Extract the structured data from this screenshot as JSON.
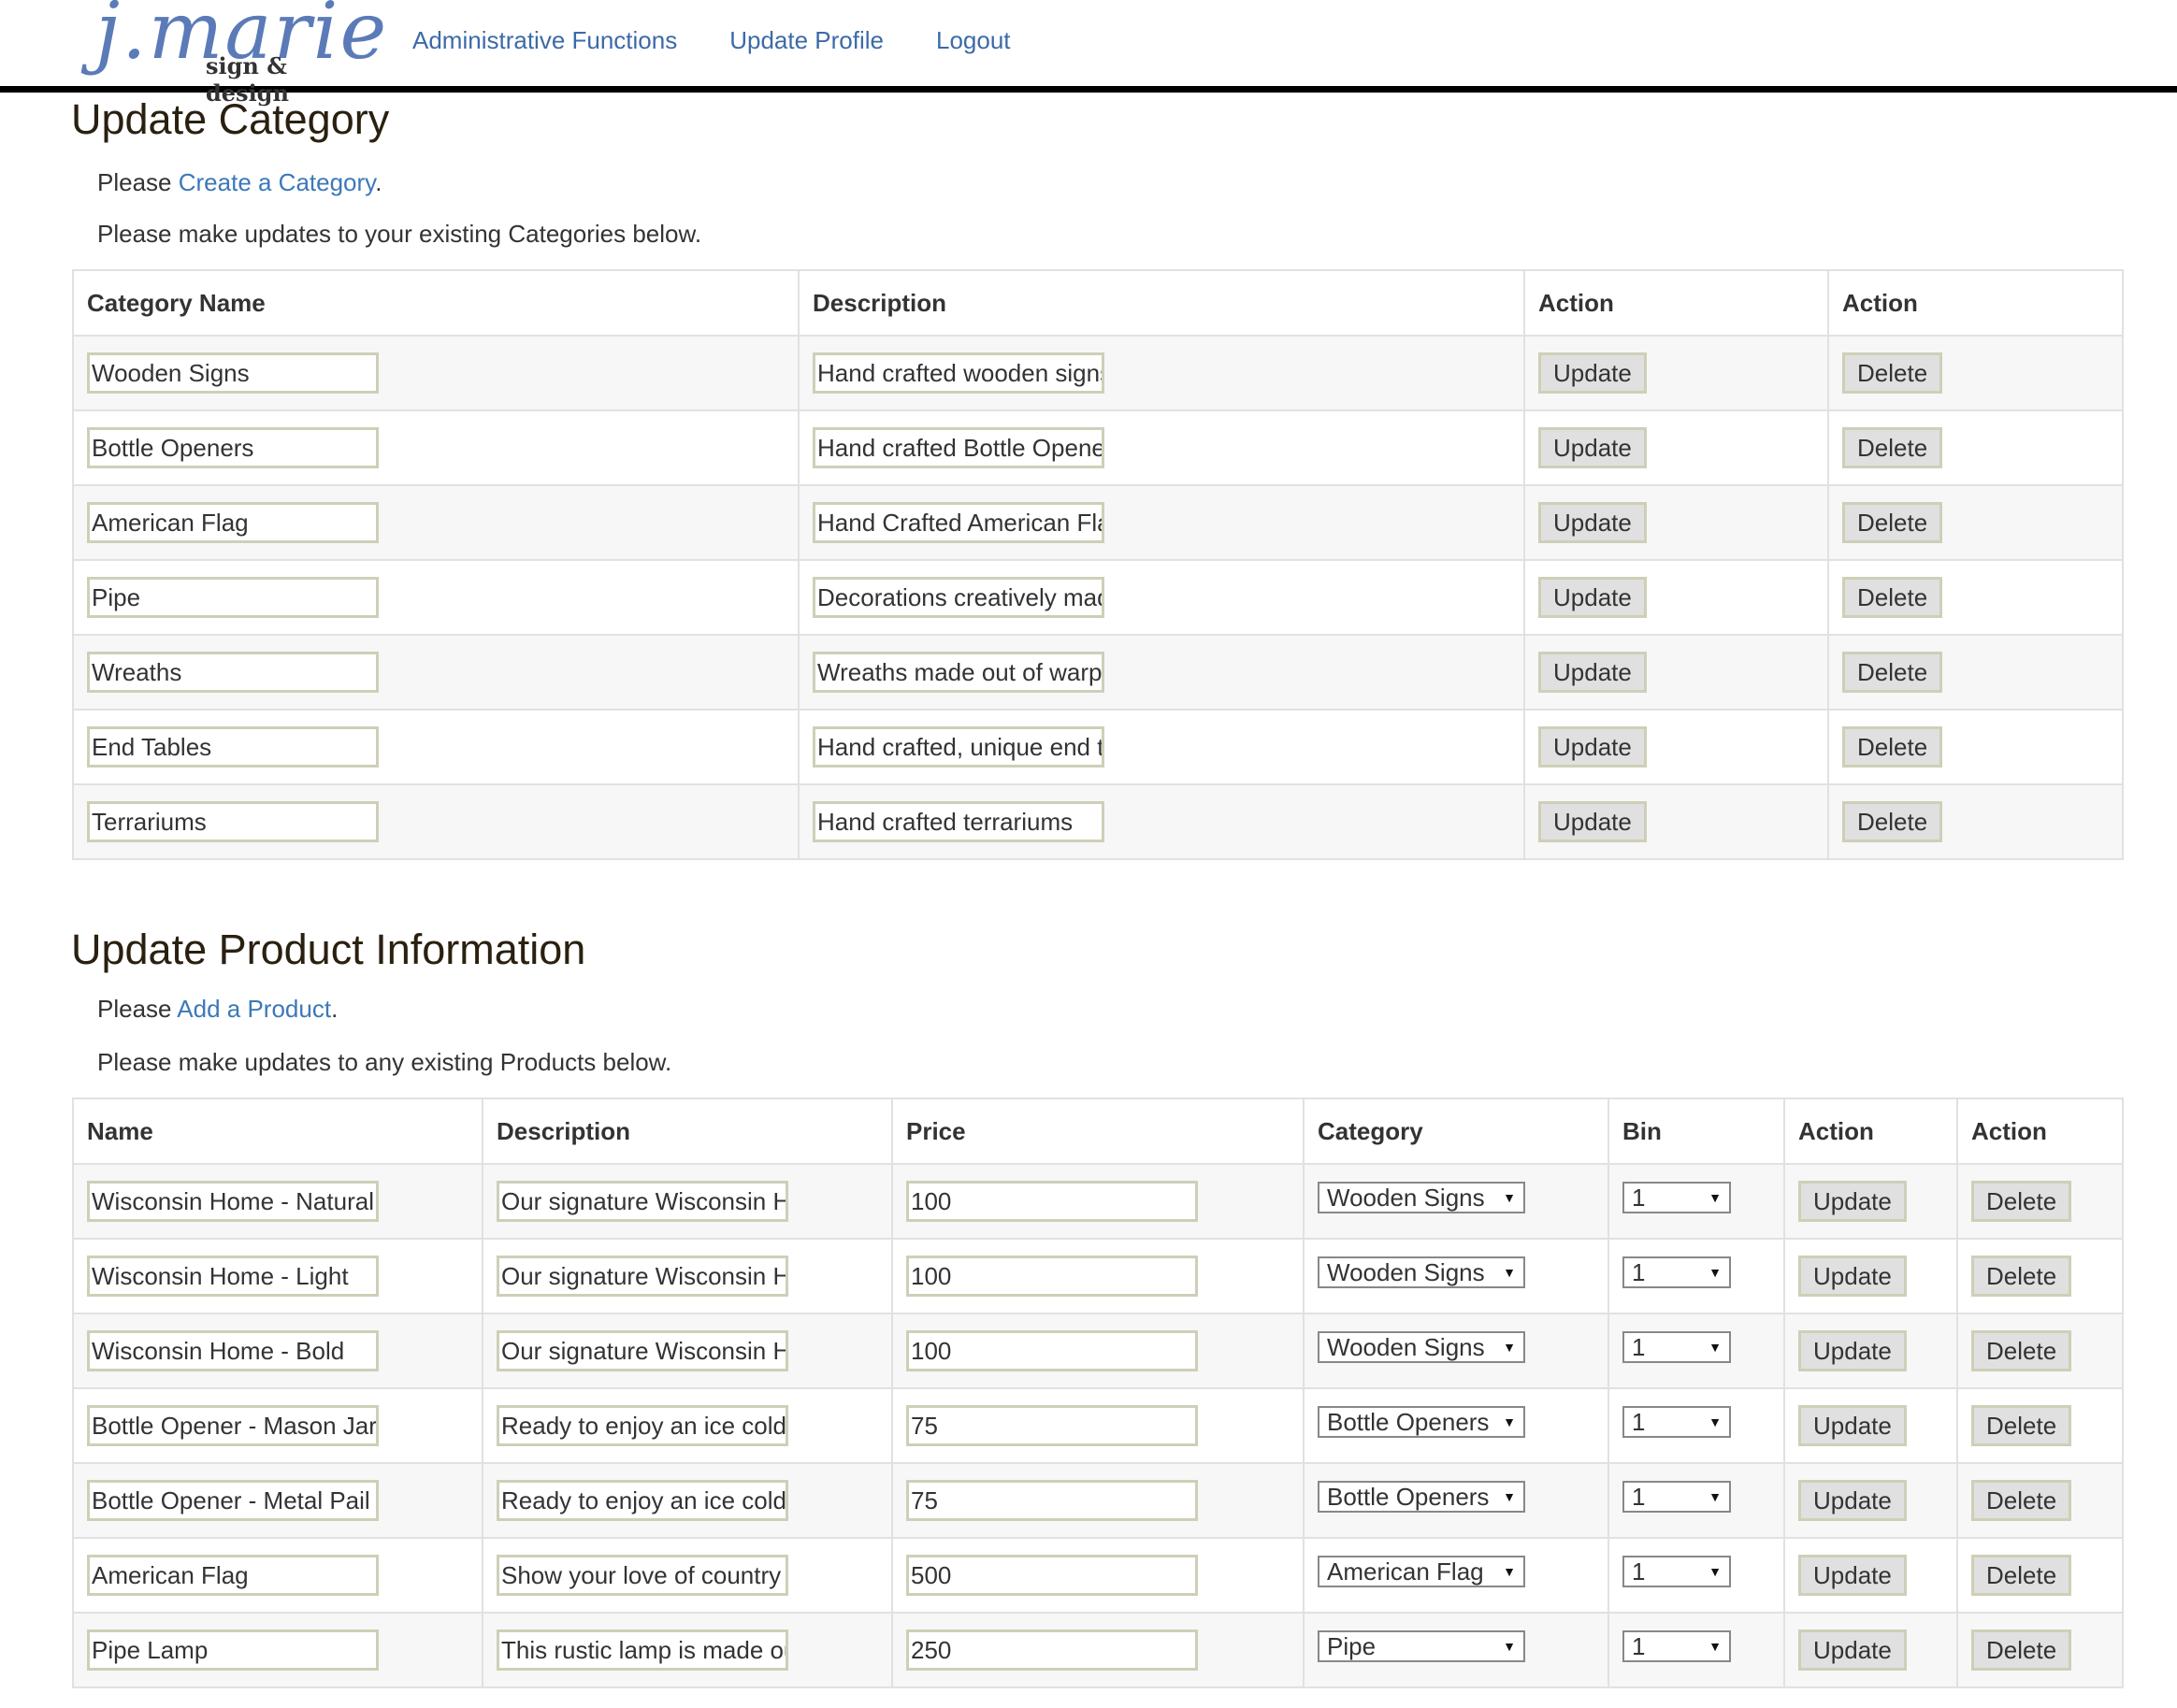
{
  "header": {
    "logo_script": "j.marie",
    "logo_sub": "sign & design",
    "nav": [
      "Administrative Functions",
      "Update Profile",
      "Logout"
    ]
  },
  "categories_section": {
    "title": "Update Category",
    "intro_prefix": "Please ",
    "intro_link": "Create a Category",
    "intro_suffix": ".",
    "subtitle": "Please make updates to your existing Categories below.",
    "columns": [
      "Category Name",
      "Description",
      "Action",
      "Action"
    ],
    "rows": [
      {
        "name": "Wooden Signs",
        "description": "Hand crafted wooden signs"
      },
      {
        "name": "Bottle Openers",
        "description": "Hand crafted Bottle Openers"
      },
      {
        "name": "American Flag",
        "description": "Hand Crafted American Flag"
      },
      {
        "name": "Pipe",
        "description": "Decorations creatively made"
      },
      {
        "name": "Wreaths",
        "description": "Wreaths made out of warp"
      },
      {
        "name": "End Tables",
        "description": "Hand crafted, unique end t"
      },
      {
        "name": "Terrariums",
        "description": "Hand crafted terrariums"
      }
    ],
    "update_label": "Update",
    "delete_label": "Delete"
  },
  "products_section": {
    "title": "Update Product Information",
    "intro_prefix": "Please ",
    "intro_link": "Add a Product",
    "intro_suffix": ".",
    "subtitle": "Please make updates to any existing Products below.",
    "columns": [
      "Name",
      "Description",
      "Price",
      "Category",
      "Bin",
      "Action",
      "Action"
    ],
    "rows": [
      {
        "name": "Wisconsin Home - Natural",
        "description": "Our signature Wisconsin H",
        "price": "100",
        "category": "Wooden Signs",
        "bin": "1"
      },
      {
        "name": "Wisconsin Home - Light",
        "description": "Our signature Wisconsin H",
        "price": "100",
        "category": "Wooden Signs",
        "bin": "1"
      },
      {
        "name": "Wisconsin Home - Bold",
        "description": "Our signature Wisconsin H",
        "price": "100",
        "category": "Wooden Signs",
        "bin": "1"
      },
      {
        "name": "Bottle Opener - Mason Jar",
        "description": "Ready to enjoy an ice cold",
        "price": "75",
        "category": "Bottle Openers",
        "bin": "1"
      },
      {
        "name": "Bottle Opener - Metal Pail",
        "description": "Ready to enjoy an ice cold",
        "price": "75",
        "category": "Bottle Openers",
        "bin": "1"
      },
      {
        "name": "American Flag",
        "description": "Show your love of country",
        "price": "500",
        "category": "American Flag",
        "bin": "1"
      },
      {
        "name": "Pipe Lamp",
        "description": "This rustic lamp is made ou",
        "price": "250",
        "category": "Pipe",
        "bin": "1"
      }
    ],
    "update_label": "Update",
    "delete_label": "Delete"
  }
}
